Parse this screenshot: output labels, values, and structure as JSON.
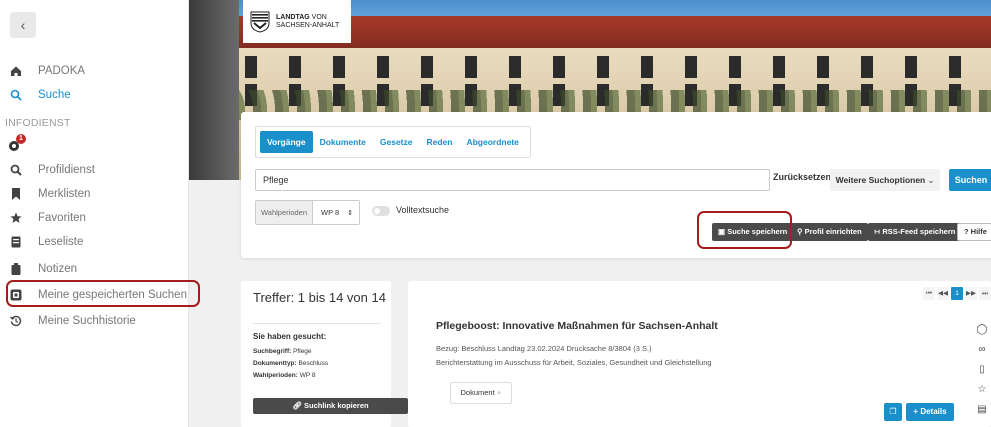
{
  "sidebar": {
    "collapse_glyph": "‹",
    "items": [
      {
        "label": "PADOKA",
        "icon": "home-icon"
      },
      {
        "label": "Suche",
        "icon": "search-icon"
      },
      {
        "label": "Profildienst",
        "icon": "zoom-icon"
      },
      {
        "label": "Merklisten",
        "icon": "bookmark-icon"
      },
      {
        "label": "Favoriten",
        "icon": "star-icon"
      },
      {
        "label": "Leseliste",
        "icon": "book-icon"
      },
      {
        "label": "Notizen",
        "icon": "note-icon"
      },
      {
        "label": "Meine gespeicherten Suchen",
        "icon": "saved-search-icon"
      },
      {
        "label": "Meine Suchhistorie",
        "icon": "history-icon"
      }
    ],
    "section_label": "INFODIENST",
    "badge_count": "1"
  },
  "header": {
    "logo_line1": "LANDTAG",
    "logo_line1b": "VON",
    "logo_line2": "SACHSEN-ANHALT"
  },
  "search": {
    "tabs": [
      "Vorgänge",
      "Dokumente",
      "Gesetze",
      "Reden",
      "Abgeordnete"
    ],
    "query": "Pflege",
    "reset_label": "Zurücksetzen",
    "more_options_label": "Weitere Suchoptionen",
    "submit_label": "Suchen",
    "period_label": "Wahlperioden",
    "period_value": "WP 8",
    "fulltext_label": "Volltextsuche",
    "save_search_label": "Suche speichern",
    "profile_label": "Profil einrichten",
    "rss_label": "RSS-Feed speichern",
    "help_label": "? Hilfe"
  },
  "results": {
    "count_text": "Treffer: 1 bis 14 von 14",
    "searched_heading": "Sie haben gesucht:",
    "criteria": [
      {
        "key": "Suchbegriff:",
        "value": "Pflege"
      },
      {
        "key": "Dokumenttyp:",
        "value": "Beschluss"
      },
      {
        "key": "Wahlperioden:",
        "value": "WP 8"
      }
    ],
    "copy_link_label": "Suchlink kopieren",
    "pager": [
      "⏮",
      "◀◀",
      "1",
      "▶▶",
      "⏭"
    ],
    "item": {
      "title": "Pflegeboost: Innovative Maßnahmen für Sachsen-Anhalt",
      "reference": "Bezug: Beschluss Landtag 23.02.2024 Drucksache 8/3804 (3 S.)",
      "description": "Berichterstattung im Ausschuss für Arbeit, Soziales, Gesundheit und Gleichstellung",
      "document_chip": "Dokument",
      "details_label": "+ Details"
    }
  },
  "colors": {
    "accent": "#1a8fc9",
    "highlight": "#a51c1c",
    "dark_button": "#4a4a4a"
  }
}
